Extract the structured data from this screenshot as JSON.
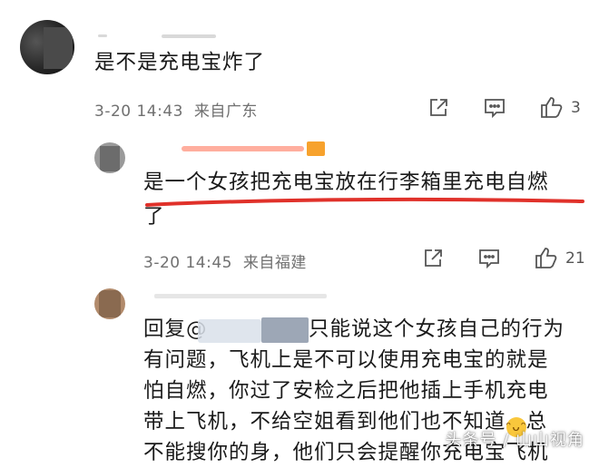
{
  "comments": [
    {
      "text": "是不是充电宝炸了",
      "time": "3-20 14:43",
      "location": "来自广东",
      "likes": "3"
    },
    {
      "text_line1": "是一个女孩把充电宝放在行李箱里充电自燃",
      "text_line2": "了",
      "time": "3-20 14:45",
      "location": "来自福建",
      "likes": "21"
    },
    {
      "reply_prefix": "回复@",
      "line1_rest": "只能说这个女孩自己的行为",
      "line2": "有问题，飞机上是不可以使用充电宝的就是",
      "line3": "怕自燃，你过了安检之后把他插上手机充电",
      "line4": "带上飞机，不给空姐看到他们也不知道",
      "line4_tail": "总",
      "line5": "不能搜你的身，他们只会提醒你充电宝飞机"
    }
  ],
  "icons": {
    "share": "share-icon",
    "comment": "comment-icon",
    "like": "thumbs-up-icon",
    "emoji": "grin-emoji"
  },
  "watermark": "头条号 / 山山视角",
  "colors": {
    "highlight": "#e0312a",
    "meta": "#707070"
  }
}
